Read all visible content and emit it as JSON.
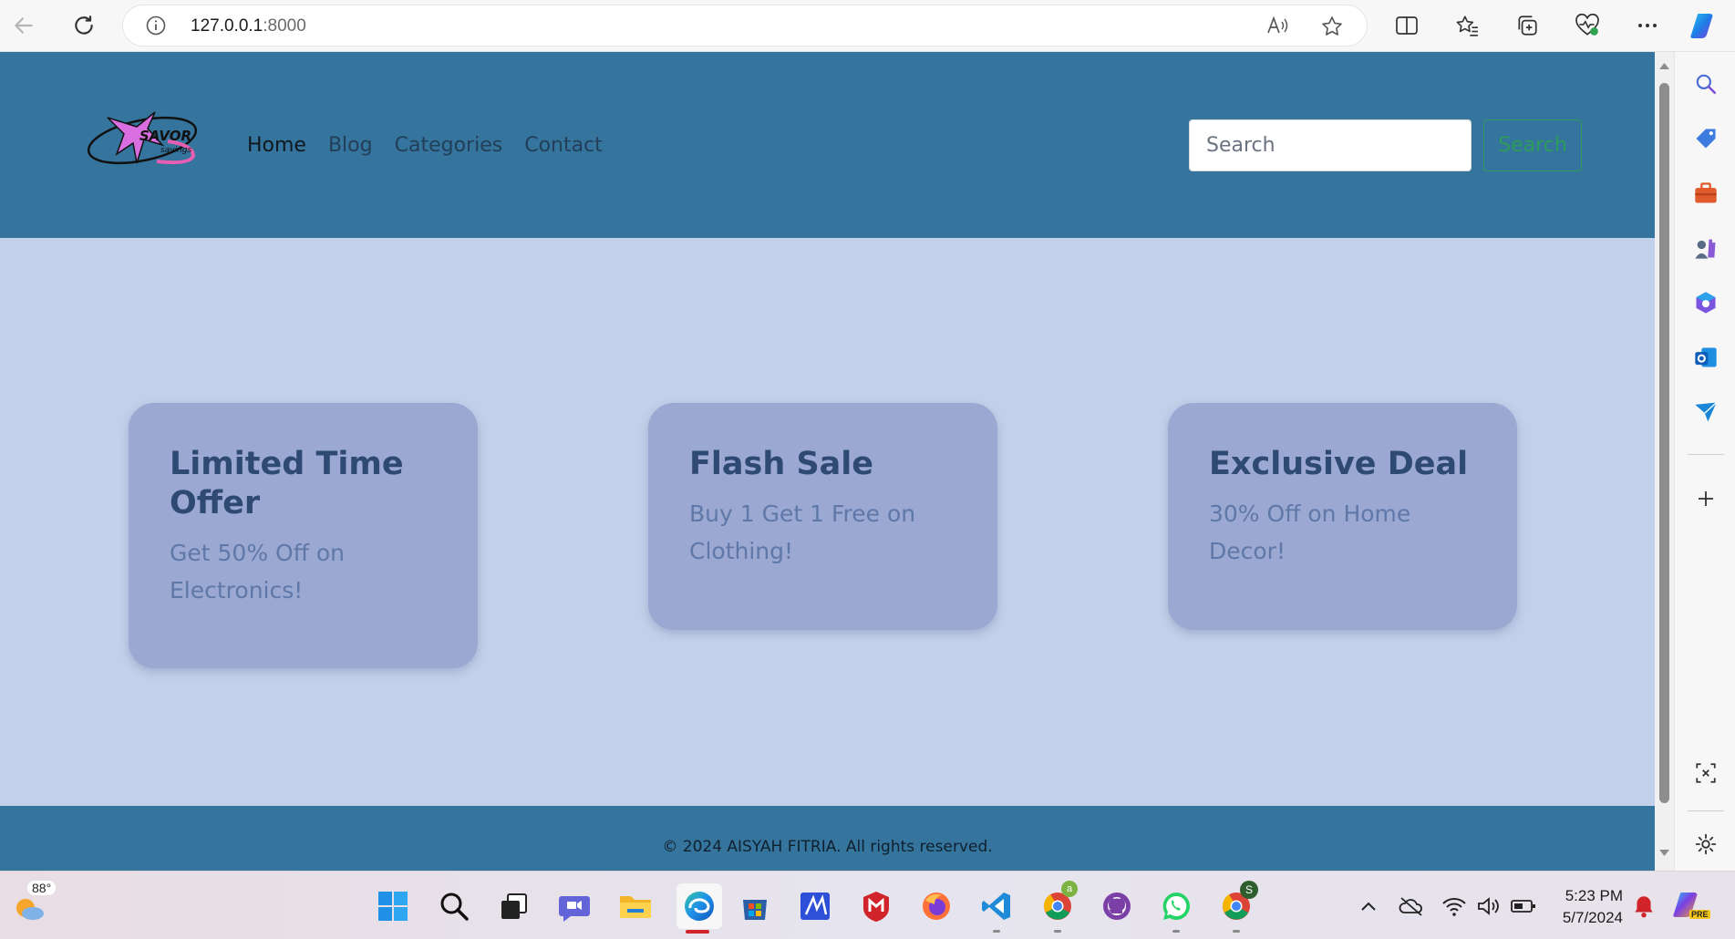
{
  "browser": {
    "url_host": "127.0.0.1",
    "url_port": ":8000"
  },
  "site": {
    "logo_text": "SAVOR",
    "logo_subtext": "savings",
    "nav": [
      "Home",
      "Blog",
      "Categories",
      "Contact"
    ],
    "search_placeholder": "Search",
    "search_button": "Search",
    "cards": [
      {
        "title": "Limited Time Offer",
        "text": "Get 50% Off on Electronics!"
      },
      {
        "title": "Flash Sale",
        "text": "Buy 1 Get 1 Free on Clothing!"
      },
      {
        "title": "Exclusive Deal",
        "text": "30% Off on Home Decor!"
      }
    ],
    "footer": "© 2024 AISYAH FITRIA. All rights reserved."
  },
  "taskbar": {
    "weather_temp": "88°",
    "time": "5:23 PM",
    "date": "5/7/2024",
    "chrome_badge_1": "a",
    "chrome_badge_2": "S",
    "copilot_badge": "PRE"
  },
  "colors": {
    "header": "#34749d",
    "page_bg": "#c3d0ea",
    "card_bg": "#9aa8d2",
    "card_title": "#2f4a72",
    "card_text": "#5f78a8",
    "search_button": "#2d9c5a"
  }
}
